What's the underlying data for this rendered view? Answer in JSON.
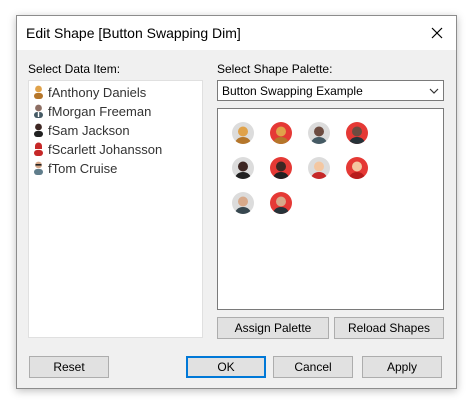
{
  "window": {
    "title": "Edit Shape [Button Swapping Dim]"
  },
  "data_items": {
    "label": "Select Data Item:",
    "items": [
      {
        "label": "fAnthony Daniels",
        "icon": "person-yellow-icon"
      },
      {
        "label": "fMorgan Freeman",
        "icon": "person-suit-icon"
      },
      {
        "label": "fSam Jackson",
        "icon": "person-dark-icon"
      },
      {
        "label": "fScarlett Johansson",
        "icon": "person-red-icon"
      },
      {
        "label": "fTom Cruise",
        "icon": "person-gray-icon"
      }
    ]
  },
  "palette": {
    "label": "Select Shape Palette:",
    "selected": "Button Swapping Example",
    "shapes": [
      {
        "name": "shape-gold-figure",
        "bg": "#dcdcdc",
        "head": "#e0a24a",
        "body": "#b5762a"
      },
      {
        "name": "shape-red-gold-figure",
        "bg": "#e53935",
        "head": "#e0a24a",
        "body": "#b5762a"
      },
      {
        "name": "shape-gray-suit-man",
        "bg": "#dcdcdc",
        "head": "#6d4c41",
        "body": "#455a64"
      },
      {
        "name": "shape-red-suit-man",
        "bg": "#e53935",
        "head": "#6d4c41",
        "body": "#263238"
      },
      {
        "name": "shape-gray-dark-man",
        "bg": "#dcdcdc",
        "head": "#3e2723",
        "body": "#212121"
      },
      {
        "name": "shape-red-dark-man",
        "bg": "#e53935",
        "head": "#3e2723",
        "body": "#212121"
      },
      {
        "name": "shape-gray-woman",
        "bg": "#dcdcdc",
        "head": "#f4c7a1",
        "body": "#c62828"
      },
      {
        "name": "shape-red-woman",
        "bg": "#e53935",
        "head": "#f4c7a1",
        "body": "#b71c1c"
      },
      {
        "name": "shape-gray-sunglasses-man",
        "bg": "#dcdcdc",
        "head": "#d7a98a",
        "body": "#37474f"
      },
      {
        "name": "shape-red-sunglasses-man",
        "bg": "#e53935",
        "head": "#d7a98a",
        "body": "#263238"
      }
    ]
  },
  "buttons": {
    "assign_palette": "Assign Palette",
    "reload_shapes": "Reload Shapes",
    "reset": "Reset",
    "ok": "OK",
    "cancel": "Cancel",
    "apply": "Apply"
  }
}
